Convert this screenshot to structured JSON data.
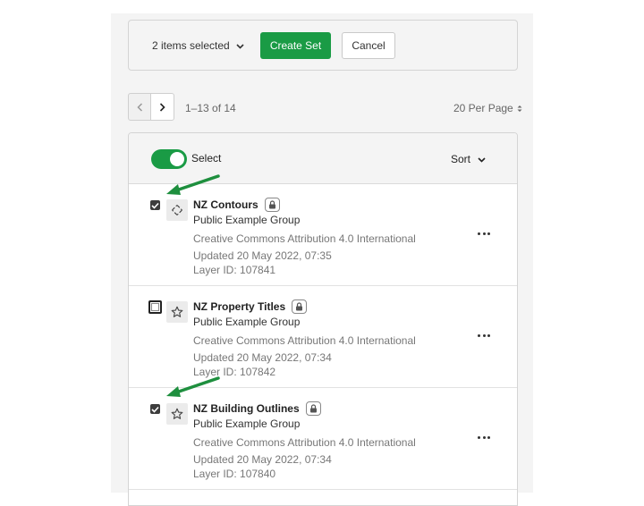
{
  "action_bar": {
    "selection_label": "2 items selected",
    "create_label": "Create Set",
    "cancel_label": "Cancel"
  },
  "pagination": {
    "range": "1–13 of 14",
    "per_page": "20 Per Page"
  },
  "list_header": {
    "select_label": "Select",
    "select_on": true,
    "sort_label": "Sort"
  },
  "items": [
    {
      "title": "NZ Contours",
      "group": "Public Example Group",
      "license": "Creative Commons Attribution 4.0 International",
      "updated": "Updated 20 May 2022, 07:35",
      "layer_id": "Layer ID: 107841",
      "checked": true,
      "icon": "layer-diamond-icon"
    },
    {
      "title": "NZ Property Titles",
      "group": "Public Example Group",
      "license": "Creative Commons Attribution 4.0 International",
      "updated": "Updated 20 May 2022, 07:34",
      "layer_id": "Layer ID: 107842",
      "checked": false,
      "icon": "star-icon"
    },
    {
      "title": "NZ Building Outlines",
      "group": "Public Example Group",
      "license": "Creative Commons Attribution 4.0 International",
      "updated": "Updated 20 May 2022, 07:34",
      "layer_id": "Layer ID: 107840",
      "checked": true,
      "icon": "star-icon"
    }
  ],
  "colors": {
    "accent_green": "#1a9b45",
    "annotation_arrow": "#1e8f3e"
  }
}
